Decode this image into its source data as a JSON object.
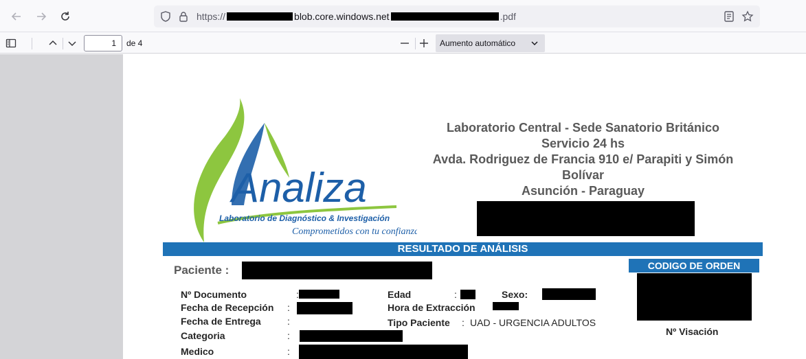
{
  "browser": {
    "url_prefix": "https://",
    "url_host": "blob.core.windows.net",
    "url_suffix": ".pdf",
    "back_icon": "arrow-left-icon",
    "forward_icon": "arrow-right-icon",
    "reload_icon": "reload-icon"
  },
  "pdf_toolbar": {
    "current_page": "1",
    "page_of": "de 4",
    "zoom_minus": "—",
    "zoom_plus": "+",
    "zoom_value": "Aumento automático"
  },
  "document": {
    "logo": {
      "brand": "Analiza",
      "tagline": "Laboratorio de Diagnóstico & Investigación",
      "slogan": "Comprometidos con tu confianza"
    },
    "lab_header": [
      "Laboratorio Central - Sede Sanatorio Británico",
      "Servicio 24 hs",
      "Avda. Rodriguez de Francia 910 e/ Parapiti y Simón",
      "Bolívar",
      "Asunción - Paraguay"
    ],
    "result_title": "RESULTADO DE ANÁLISIS",
    "patient_label": "Paciente :",
    "order_code_label": "CODIGO DE ORDEN",
    "visacion_label": "Nº Visación",
    "fields": {
      "documento": "Nº Documento",
      "recepcion": "Fecha de Recepción",
      "entrega": "Fecha de Entrega",
      "categoria": "Categoria",
      "medico": "Medico",
      "edad": "Edad",
      "sexo": "Sexo:",
      "hora": "Hora de Extracción",
      "tipo": "Tipo Paciente",
      "tipo_value": "UAD - URGENCIA ADULTOS"
    },
    "colon": ":"
  },
  "colors": {
    "accent_blue": "#1f73b7",
    "logo_green": "#8dc63f",
    "logo_blue": "#1d5fa8"
  }
}
